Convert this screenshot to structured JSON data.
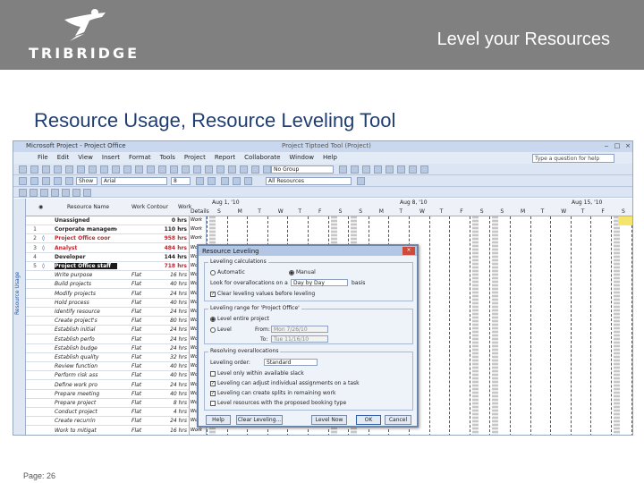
{
  "slide": {
    "logo_text": "TRIBRIDGE",
    "title": "Level your Resources",
    "subtitle": "Resource Usage, Resource Leveling Tool",
    "footer": "Page: 26"
  },
  "app": {
    "window_title": "Microsoft Project - Project Office",
    "center_title": "Project Tiptoed Tool (Project)",
    "menus": [
      "File",
      "Edit",
      "View",
      "Insert",
      "Format",
      "Tools",
      "Project",
      "Report",
      "Collaborate",
      "Window",
      "Help"
    ],
    "help_placeholder": "Type a question for help",
    "group_combo": "No Group",
    "font_combo": "Arial",
    "size_combo": "8",
    "filter_combo": "All Resources",
    "show_label": "Show",
    "sidebar_label": "Resource Usage"
  },
  "table": {
    "headers": {
      "name": "Resource Name",
      "wc": "Work Contour",
      "work": "Work",
      "details": "Details"
    },
    "rows": [
      {
        "id": "",
        "ind": "",
        "name": "Unassigned",
        "wc": "",
        "work": "0 hrs",
        "style": "bold"
      },
      {
        "id": "1",
        "ind": "",
        "name": "Corporate manageme",
        "wc": "",
        "work": "110 hrs",
        "style": "bold"
      },
      {
        "id": "2",
        "ind": "◊",
        "name": "Project Office coor",
        "wc": "",
        "work": "958 hrs",
        "style": "red"
      },
      {
        "id": "3",
        "ind": "◊",
        "name": "Analyst",
        "wc": "",
        "work": "484 hrs",
        "style": "red"
      },
      {
        "id": "4",
        "ind": "",
        "name": "Developer",
        "wc": "",
        "work": "144 hrs",
        "style": "bold"
      },
      {
        "id": "5",
        "ind": "◊",
        "name": "Project Office staff",
        "wc": "",
        "work": "718 hrs",
        "style": "selected"
      },
      {
        "id": "",
        "ind": "",
        "name": "Write purpose",
        "wc": "Flat",
        "work": "16 hrs",
        "style": ""
      },
      {
        "id": "",
        "ind": "",
        "name": "Build projects",
        "wc": "Flat",
        "work": "40 hrs",
        "style": ""
      },
      {
        "id": "",
        "ind": "",
        "name": "Modify projects",
        "wc": "Flat",
        "work": "24 hrs",
        "style": ""
      },
      {
        "id": "",
        "ind": "",
        "name": "Hold process",
        "wc": "Flat",
        "work": "40 hrs",
        "style": ""
      },
      {
        "id": "",
        "ind": "",
        "name": "Identify resource",
        "wc": "Flat",
        "work": "24 hrs",
        "style": ""
      },
      {
        "id": "",
        "ind": "",
        "name": "Create project's",
        "wc": "Flat",
        "work": "80 hrs",
        "style": ""
      },
      {
        "id": "",
        "ind": "",
        "name": "Establish initial",
        "wc": "Flat",
        "work": "24 hrs",
        "style": ""
      },
      {
        "id": "",
        "ind": "",
        "name": "Establish perfo",
        "wc": "Flat",
        "work": "24 hrs",
        "style": ""
      },
      {
        "id": "",
        "ind": "",
        "name": "Establish budge",
        "wc": "Flat",
        "work": "24 hrs",
        "style": ""
      },
      {
        "id": "",
        "ind": "",
        "name": "Establish quality",
        "wc": "Flat",
        "work": "32 hrs",
        "style": ""
      },
      {
        "id": "",
        "ind": "",
        "name": "Review function",
        "wc": "Flat",
        "work": "40 hrs",
        "style": ""
      },
      {
        "id": "",
        "ind": "",
        "name": "Perform risk ass",
        "wc": "Flat",
        "work": "40 hrs",
        "style": ""
      },
      {
        "id": "",
        "ind": "",
        "name": "Define work pro",
        "wc": "Flat",
        "work": "24 hrs",
        "style": ""
      },
      {
        "id": "",
        "ind": "",
        "name": "Prepare meeting",
        "wc": "Flat",
        "work": "40 hrs",
        "style": ""
      },
      {
        "id": "",
        "ind": "",
        "name": "Prepare project",
        "wc": "Flat",
        "work": "8 hrs",
        "style": ""
      },
      {
        "id": "",
        "ind": "",
        "name": "Conduct project",
        "wc": "Flat",
        "work": "4 hrs",
        "style": ""
      },
      {
        "id": "",
        "ind": "",
        "name": "Create recurrin",
        "wc": "Flat",
        "work": "24 hrs",
        "style": ""
      },
      {
        "id": "",
        "ind": "",
        "name": "Work to mitigat",
        "wc": "Flat",
        "work": "16 hrs",
        "style": ""
      }
    ],
    "details_value": "Work",
    "weeks": [
      "Aug 1, '10",
      "Aug 8, '10",
      "Aug 15, '10"
    ],
    "days": [
      "S",
      "M",
      "T",
      "W",
      "T",
      "F",
      "S"
    ]
  },
  "dialog": {
    "title": "Resource Leveling",
    "calc_legend": "Leveling calculations",
    "automatic": "Automatic",
    "manual": "Manual",
    "look_for": "Look for overallocations on a",
    "basis_value": "Day by Day",
    "basis": "basis",
    "clear_values": "Clear leveling values before leveling",
    "range_legend": "Leveling range for 'Project Office'",
    "level_entire": "Level entire project",
    "level_from": "Level",
    "from_label": "From:",
    "from_value": "Mon 7/26/10",
    "to_label": "To:",
    "to_value": "Tue 11/16/10",
    "resolve_legend": "Resolving overallocations",
    "order_label": "Leveling order:",
    "order_value": "Standard",
    "opt1": "Level only within available slack",
    "opt2": "Leveling can adjust individual assignments on a task",
    "opt3": "Leveling can create splits in remaining work",
    "opt4": "Level resources with the proposed booking type",
    "help": "Help",
    "clear": "Clear Leveling...",
    "level_now": "Level Now",
    "ok": "OK",
    "cancel": "Cancel"
  },
  "colors": {
    "header_band": "#808080",
    "subtitle": "#1f3f73",
    "overallocated": "#c0262e",
    "highlight": "#f5e66b"
  }
}
